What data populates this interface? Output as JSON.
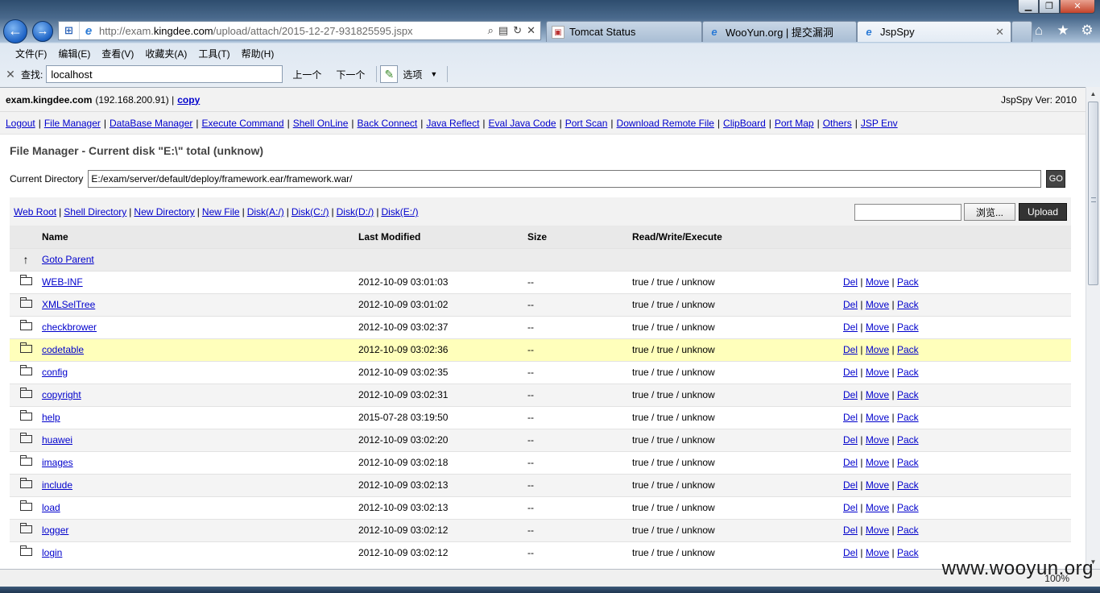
{
  "browser": {
    "address_url_pre": "http://exam.",
    "address_url_host": "kingdee.com",
    "address_url_post": "/upload/attach/2015-12-27-931825595.jspx",
    "tabs": [
      {
        "label": "Tomcat Status"
      },
      {
        "label": "WooYun.org | 提交漏洞"
      },
      {
        "label": "JspSpy"
      }
    ],
    "menu": [
      "文件(F)",
      "编辑(E)",
      "查看(V)",
      "收藏夹(A)",
      "工具(T)",
      "帮助(H)"
    ],
    "find": {
      "label": "查找:",
      "value": "localhost",
      "prev": "上一个",
      "next": "下一个",
      "options": "选项"
    },
    "zoom": "100%"
  },
  "page": {
    "host": "exam.kingdee.com",
    "ip": "(192.168.200.91) |",
    "copy_link": "copy",
    "version": "JspSpy Ver: 2010",
    "nav_links": [
      "Logout",
      "File Manager",
      "DataBase Manager",
      "Execute Command",
      "Shell OnLine",
      "Back Connect",
      "Java Reflect",
      "Eval Java Code",
      "Port Scan",
      "Download Remote File",
      "ClipBoard",
      "Port Map",
      "Others",
      "JSP Env"
    ],
    "title": "File Manager - Current disk \"E:\\\" total (unknow)",
    "current_dir_label": "Current Directory",
    "current_dir_value": "E:/exam/server/default/deploy/framework.ear/framework.war/",
    "go_label": "GO",
    "dir_links": [
      "Web Root",
      "Shell Directory",
      "New Directory",
      "New File",
      "Disk(A:/)",
      "Disk(C:/)",
      "Disk(D:/)",
      "Disk(E:/)"
    ],
    "browse_label": "浏览...",
    "upload_label": "Upload",
    "columns": {
      "name": "Name",
      "modified": "Last Modified",
      "size": "Size",
      "rwx": "Read/Write/Execute"
    },
    "parent_link": "Goto Parent",
    "action_del": "Del",
    "action_move": "Move",
    "action_pack": "Pack",
    "files": [
      {
        "name": "WEB-INF",
        "modified": "2012-10-09 03:01:03",
        "size": "--",
        "rwx": "true / true / unknow"
      },
      {
        "name": "XMLSelTree",
        "modified": "2012-10-09 03:01:02",
        "size": "--",
        "rwx": "true / true / unknow"
      },
      {
        "name": "checkbrower",
        "modified": "2012-10-09 03:02:37",
        "size": "--",
        "rwx": "true / true / unknow"
      },
      {
        "name": "codetable",
        "modified": "2012-10-09 03:02:36",
        "size": "--",
        "rwx": "true / true / unknow"
      },
      {
        "name": "config",
        "modified": "2012-10-09 03:02:35",
        "size": "--",
        "rwx": "true / true / unknow"
      },
      {
        "name": "copyright",
        "modified": "2012-10-09 03:02:31",
        "size": "--",
        "rwx": "true / true / unknow"
      },
      {
        "name": "help",
        "modified": "2015-07-28 03:19:50",
        "size": "--",
        "rwx": "true / true / unknow"
      },
      {
        "name": "huawei",
        "modified": "2012-10-09 03:02:20",
        "size": "--",
        "rwx": "true / true / unknow"
      },
      {
        "name": "images",
        "modified": "2012-10-09 03:02:18",
        "size": "--",
        "rwx": "true / true / unknow"
      },
      {
        "name": "include",
        "modified": "2012-10-09 03:02:13",
        "size": "--",
        "rwx": "true / true / unknow"
      },
      {
        "name": "load",
        "modified": "2012-10-09 03:02:13",
        "size": "--",
        "rwx": "true / true / unknow"
      },
      {
        "name": "logger",
        "modified": "2012-10-09 03:02:12",
        "size": "--",
        "rwx": "true / true / unknow"
      },
      {
        "name": "login",
        "modified": "2012-10-09 03:02:12",
        "size": "--",
        "rwx": "true / true / unknow"
      }
    ]
  },
  "watermark": "www.wooyun.org"
}
